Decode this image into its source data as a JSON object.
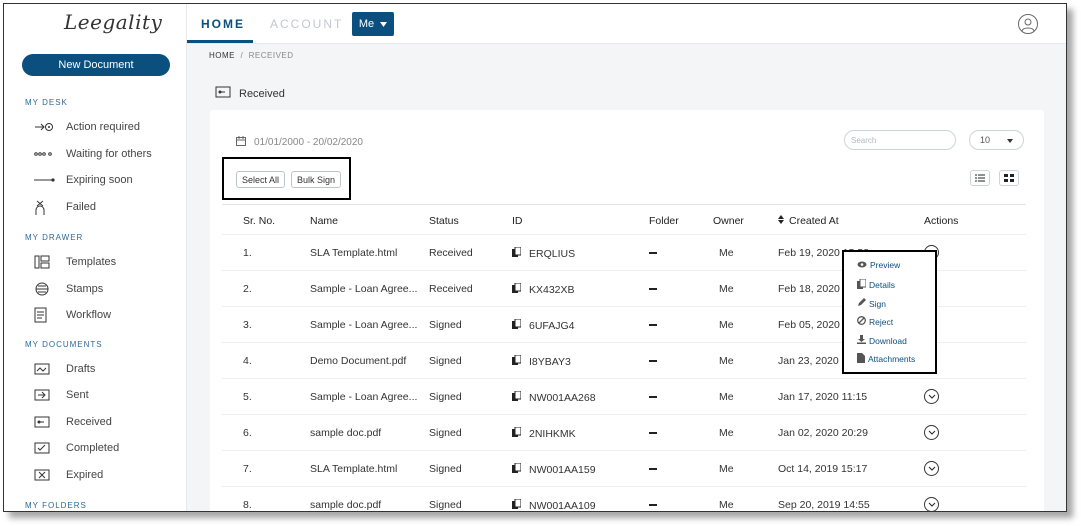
{
  "brand": {
    "logo_text": "Leegality"
  },
  "sidebar": {
    "new_document": "New Document",
    "sections": {
      "my_desk": "MY DESK",
      "my_drawer": "MY DRAWER",
      "my_documents": "MY DOCUMENTS",
      "my_folders": "MY FOLDERS"
    },
    "desk_items": [
      "Action required",
      "Waiting for others",
      "Expiring soon",
      "Failed"
    ],
    "drawer_items": [
      "Templates",
      "Stamps",
      "Workflow"
    ],
    "document_items": [
      "Drafts",
      "Sent",
      "Received",
      "Completed",
      "Expired"
    ]
  },
  "topbar": {
    "tabs": [
      "HOME",
      "ACCOUNT"
    ],
    "me_label": "Me"
  },
  "breadcrumb": {
    "home": "HOME",
    "separator": "/",
    "current": "RECEIVED"
  },
  "page": {
    "title": "Received"
  },
  "toolbar": {
    "date_range": "01/01/2000 - 20/02/2020",
    "search_placeholder": "Search",
    "per_page": "10",
    "select_all": "Select All",
    "bulk_sign": "Bulk Sign"
  },
  "table": {
    "headers": [
      "Sr. No.",
      "Name",
      "Status",
      "ID",
      "Folder",
      "Owner",
      "Created At",
      "Actions"
    ],
    "rows": [
      {
        "sr": "1.",
        "name": "SLA Template.html",
        "status": "Received",
        "id": "ERQLIUS",
        "owner": "Me",
        "created": "Feb 19, 2020 15:58"
      },
      {
        "sr": "2.",
        "name": "Sample - Loan Agree...",
        "status": "Received",
        "id": "KX432XB",
        "owner": "Me",
        "created": "Feb 18, 2020 11:"
      },
      {
        "sr": "3.",
        "name": "Sample - Loan Agree...",
        "status": "Signed",
        "id": "6UFAJG4",
        "owner": "Me",
        "created": "Feb 05, 2020 14:"
      },
      {
        "sr": "4.",
        "name": "Demo Document.pdf",
        "status": "Signed",
        "id": "I8YBAY3",
        "owner": "Me",
        "created": "Jan 23, 2020 1"
      },
      {
        "sr": "5.",
        "name": "Sample - Loan Agree...",
        "status": "Signed",
        "id": "NW001AA268",
        "owner": "Me",
        "created": "Jan 17, 2020 11:15"
      },
      {
        "sr": "6.",
        "name": "sample doc.pdf",
        "status": "Signed",
        "id": "2NIHKMK",
        "owner": "Me",
        "created": "Jan 02, 2020 20:29"
      },
      {
        "sr": "7.",
        "name": "SLA Template.html",
        "status": "Signed",
        "id": "NW001AA159",
        "owner": "Me",
        "created": "Oct 14, 2019 15:17"
      },
      {
        "sr": "8.",
        "name": "sample doc.pdf",
        "status": "Signed",
        "id": "NW001AA109",
        "owner": "Me",
        "created": "Sep 20, 2019 14:55"
      }
    ]
  },
  "actions_menu": [
    "Preview",
    "Details",
    "Sign",
    "Reject",
    "Download",
    "Attachments"
  ],
  "colors": {
    "primary": "#0b4f7e",
    "background": "#f4f5f7"
  }
}
